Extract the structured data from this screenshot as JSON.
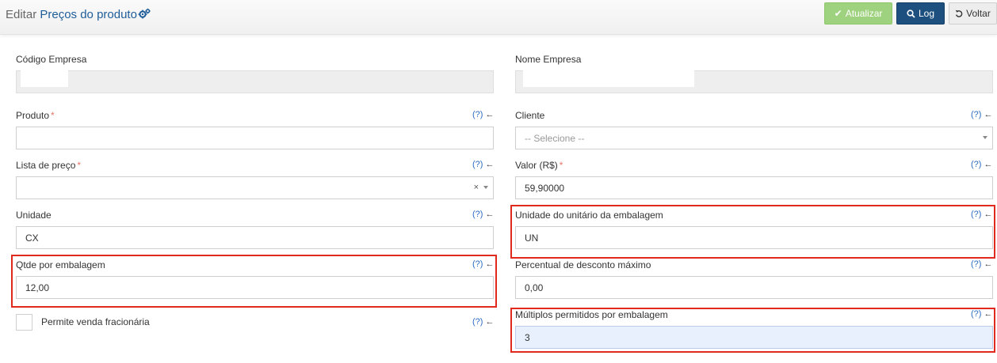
{
  "header": {
    "prefix": "Editar",
    "entity": "Preços do produto",
    "buttons": {
      "update_label": "Atualizar",
      "log_label": "Log",
      "back_label": "Voltar"
    }
  },
  "help": {
    "q": "(?)",
    "arrow": "←"
  },
  "form": {
    "codigo_empresa": {
      "label": "Código Empresa"
    },
    "nome_empresa": {
      "label": "Nome Empresa"
    },
    "produto": {
      "label": "Produto",
      "required_mark": "*",
      "value": ""
    },
    "cliente": {
      "label": "Cliente",
      "placeholder": "-- Selecione --"
    },
    "lista_preco": {
      "label": "Lista de preço",
      "required_mark": "*",
      "value": "",
      "clear": "×"
    },
    "valor": {
      "label": "Valor (R$)",
      "required_mark": "*",
      "value": "59,90000"
    },
    "unidade": {
      "label": "Unidade",
      "value": "CX"
    },
    "unidade_unitario": {
      "label": "Unidade do unitário da embalagem",
      "value": "UN"
    },
    "qtde_embalagem": {
      "label": "Qtde por embalagem",
      "value": "12,00"
    },
    "percentual_desconto": {
      "label": "Percentual de desconto máximo",
      "value": "0,00"
    },
    "venda_fracionaria": {
      "label": "Permite venda fracionária",
      "checked": false
    },
    "multiplos_embalagem": {
      "label": "Múltiplos permitidos por embalagem",
      "value": "3"
    }
  },
  "colors": {
    "primary_blue": "#1d4f7f",
    "update_green": "#9ed27e",
    "highlight_red": "#e02a1e",
    "required_red": "#e8776a",
    "link_blue": "#2a6cc0"
  }
}
